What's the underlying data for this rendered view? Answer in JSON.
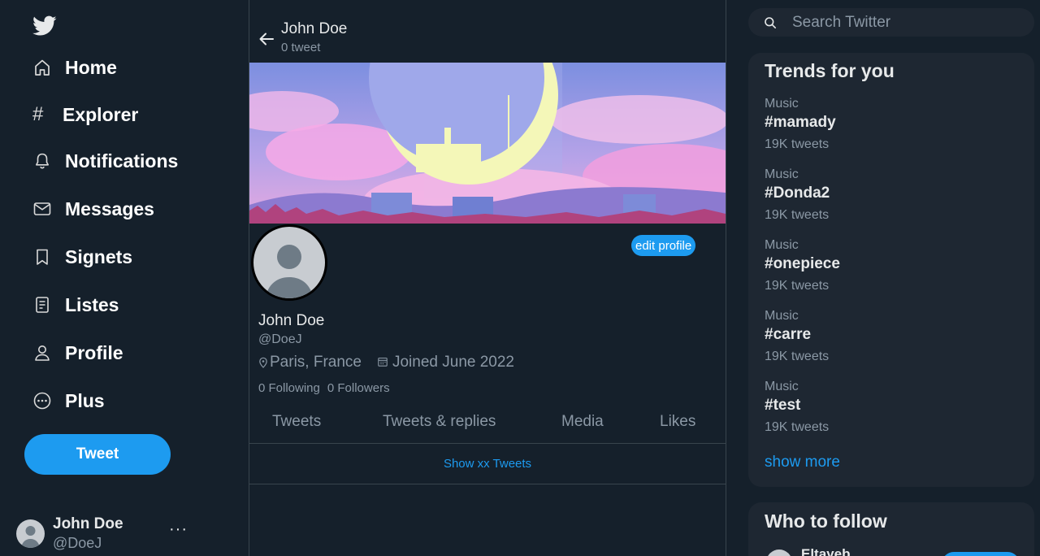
{
  "sidebar": {
    "logo_icon": "twitter-bird-icon",
    "nav": [
      {
        "label": "Home",
        "icon": "home-icon"
      },
      {
        "label": "Explorer",
        "icon": "hash-icon",
        "glyph": "#"
      },
      {
        "label": "Notifications",
        "icon": "bell-icon"
      },
      {
        "label": "Messages",
        "icon": "envelope-icon"
      },
      {
        "label": "Signets",
        "icon": "bookmark-icon"
      },
      {
        "label": "Listes",
        "icon": "list-icon"
      },
      {
        "label": "Profile",
        "icon": "person-icon"
      },
      {
        "label": "Plus",
        "icon": "more-circle-icon"
      }
    ],
    "tweet_button": "Tweet",
    "account": {
      "name": "John Doe",
      "handle": "@DoeJ",
      "more": "···"
    }
  },
  "header": {
    "name": "John Doe",
    "tweet_count": "0 tweet"
  },
  "profile": {
    "edit_button": "edit profile",
    "name": "John Doe",
    "handle": "@DoeJ",
    "location": "Paris, France",
    "joined": "Joined June 2022",
    "following": "0 Following",
    "followers": "0 Followers"
  },
  "tabs": [
    "Tweets",
    "Tweets & replies",
    "Media",
    "Likes"
  ],
  "show_tweets": "Show xx Tweets",
  "search": {
    "placeholder": "Search Twitter"
  },
  "trends": {
    "title": "Trends for you",
    "items": [
      {
        "category": "Music",
        "tag": "#mamady",
        "count": "19K tweets"
      },
      {
        "category": "Music",
        "tag": "#Donda2",
        "count": "19K tweets"
      },
      {
        "category": "Music",
        "tag": "#onepiece",
        "count": "19K tweets"
      },
      {
        "category": "Music",
        "tag": "#carre",
        "count": "19K tweets"
      },
      {
        "category": "Music",
        "tag": "#test",
        "count": "19K tweets"
      }
    ],
    "show_more": "show more"
  },
  "who_to_follow": {
    "title": "Who to follow",
    "first_name": "Eltayeb"
  },
  "colors": {
    "background": "#15202b",
    "accent": "#1d9bf0",
    "panel": "#1e2732",
    "muted": "#8b98a5"
  }
}
